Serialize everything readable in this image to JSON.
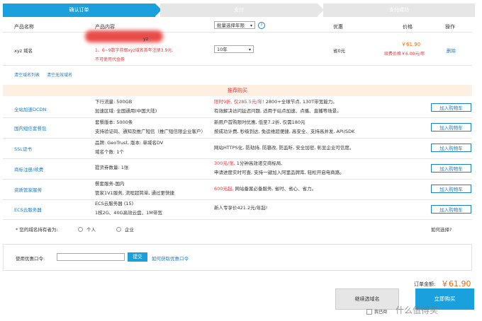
{
  "steps": [
    "确认订单",
    "支付",
    "支付成功"
  ],
  "header": {
    "col_name": "产品名称",
    "col_content": "产品内容",
    "period_select": "批量选择年限",
    "col_discount": "优惠",
    "col_price": "价格",
    "col_action": "操作"
  },
  "order": {
    "name": "xyz 域名",
    "content_suffix": "yz",
    "promo_text": "1、6~9数字前缀xyz域名首年注册3.9元,",
    "no_voucher": "不可使用代金券",
    "years": "10年",
    "discount": "省0元",
    "price": "￥61.90",
    "renew_price": "续费价格￥6.00元/年",
    "delete": "删除"
  },
  "links": {
    "clear_list": "清空域名列表",
    "clear_invalid": "清空无效域名"
  },
  "recommend": {
    "title": "推荐购买",
    "add_label": "加入购物车",
    "rows": [
      {
        "name": "全站加速DCDN",
        "c2": [
          "下行流量: 500GB",
          "加速区域: 全国通用(中国大陆)"
        ],
        "c3a": "限时9折, 仅285.5元/年!",
        "c3b": " 2800+全球节点, 130T带宽能力。",
        "c3c": "有效解决访问延迟问题, 适用于站点加速、点播、直播等场景。"
      },
      {
        "name": "国内短信套餐包",
        "c2": [
          "套餐版本: 5000条",
          "支持验证码、通知及推广短信（推广短信限企业客户）"
        ],
        "c3a": "",
        "c3b": "新用户首购限时优惠, 低至7.2折, 仅需180元",
        "c3c": "按成功计费, 秒级到达, 免运维超便捷, 高安全、支持高并发, API/SDK"
      },
      {
        "name": "SSL证书",
        "c2": [
          "品牌: GeoTrust, 版本: 单域名DV",
          "域名个数: 1个"
        ],
        "c3a": "",
        "c3b": "网站HTTPS化, 防劫持, 防篡改, 防监听, 安全加密, 彰显企业可信度。",
        "c3c": ""
      },
      {
        "name": "商标注册/续费",
        "c2": [
          "提货券数量: 1张"
        ],
        "c3a": "300元/张, ",
        "c3b": "1分钟高效递交商标局,",
        "c3c": "申请进度实时可查, 支持一键加入阿里品牌库, 轻松开启电商路。"
      },
      {
        "name": "资质管家服务",
        "c2": [
          "餐套服务-国内",
          "管家1V1服务, 流程超简单, 通过更快捷"
        ],
        "c3a": "600元起, ",
        "c3b": "网站备案必备服务, 省时、省心、省力。",
        "c3c": ""
      },
      {
        "name": "ECS云服务器",
        "c2": [
          "ECS云服务器 (15)",
          "1核2G、40G高效云盘、1M带宽"
        ],
        "c3a": "",
        "c3b": "新人专享价421.2元/年起!",
        "c3c": ""
      }
    ]
  },
  "owner": {
    "label": "* 您的域名持有者为:",
    "opt_personal": "个人",
    "opt_company": "企业",
    "how_choose": "如何选择?"
  },
  "coupon": {
    "label": "使用优惠口令:",
    "value": "",
    "submit": "提交",
    "how_get": "如何获取优惠口令"
  },
  "total": {
    "label": "订单金额:",
    "amount": "￥61.90"
  },
  "actions": {
    "continue": "继续选域名",
    "buy": "立即购买",
    "agree": "我已阅"
  },
  "watermark": "什么值得买",
  "colors": {
    "primary": "#1aa1dd",
    "price": "#ff6600",
    "link": "#1a7ec2",
    "alert": "#e4393c"
  }
}
